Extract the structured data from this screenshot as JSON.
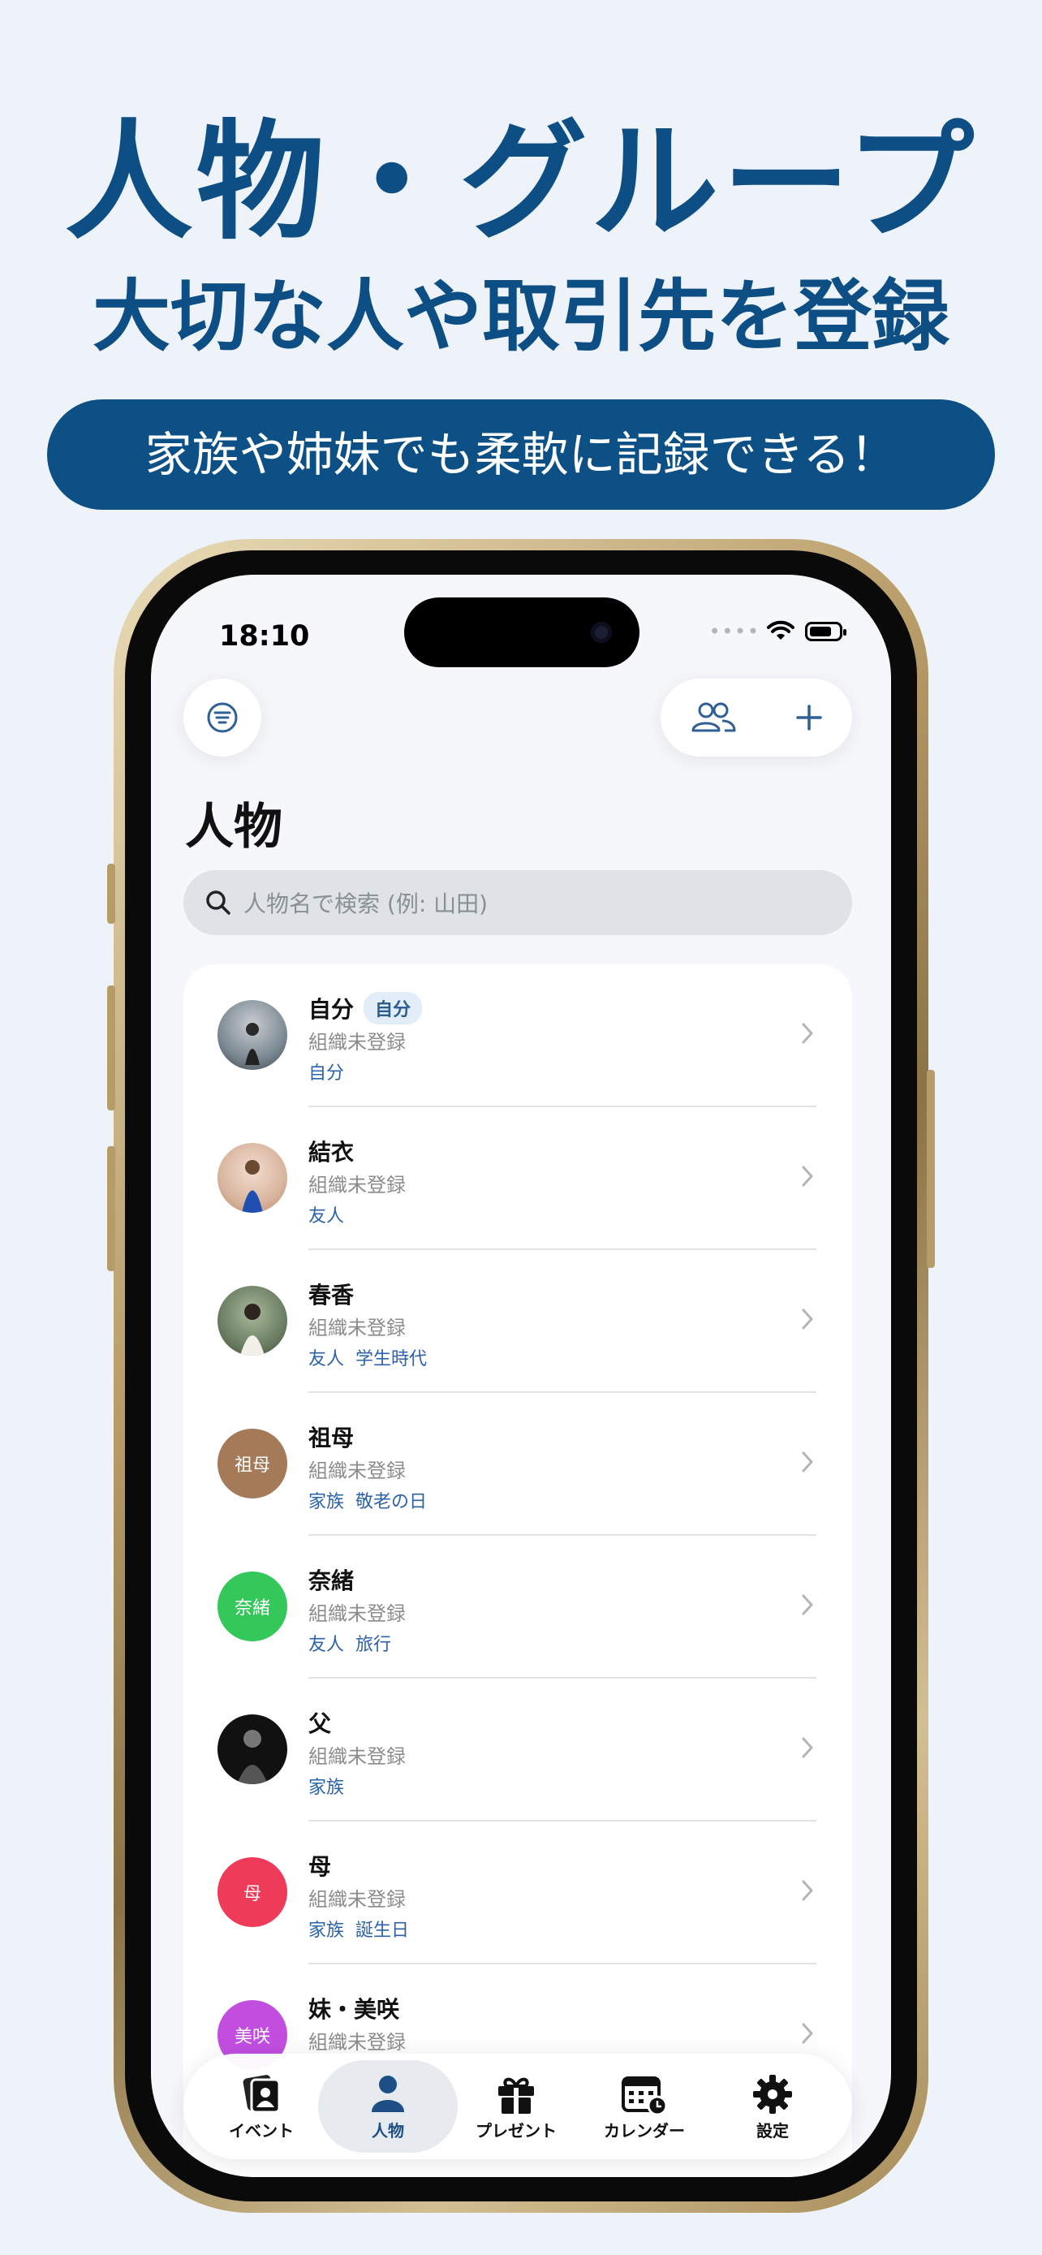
{
  "promo": {
    "title": "人物・グループ",
    "subtitle": "大切な人や取引先を登録",
    "pill": "家族や姉妹でも柔軟に記録できる！"
  },
  "status": {
    "time": "18:10"
  },
  "screen": {
    "title": "人物",
    "search_placeholder": "人物名で検索 (例: 山田)"
  },
  "people": [
    {
      "name": "自分",
      "badge": "自分",
      "org": "組織未登録",
      "tags": [
        "自分"
      ],
      "avatar_type": "photo",
      "avatar_color": "#7c8a94"
    },
    {
      "name": "結衣",
      "org": "組織未登録",
      "tags": [
        "友人"
      ],
      "avatar_type": "photo",
      "avatar_color": "#c99a7a"
    },
    {
      "name": "春香",
      "org": "組織未登録",
      "tags": [
        "友人",
        "学生時代"
      ],
      "avatar_type": "photo",
      "avatar_color": "#6c7f63"
    },
    {
      "name": "祖母",
      "org": "組織未登録",
      "tags": [
        "家族",
        "敬老の日"
      ],
      "avatar_type": "text",
      "avatar_text": "祖母",
      "avatar_color": "#a57a58"
    },
    {
      "name": "奈緒",
      "org": "組織未登録",
      "tags": [
        "友人",
        "旅行"
      ],
      "avatar_type": "text",
      "avatar_text": "奈緒",
      "avatar_color": "#34c759"
    },
    {
      "name": "父",
      "org": "組織未登録",
      "tags": [
        "家族"
      ],
      "avatar_type": "photo",
      "avatar_color": "#1a1a1a"
    },
    {
      "name": "母",
      "org": "組織未登録",
      "tags": [
        "家族",
        "誕生日"
      ],
      "avatar_type": "text",
      "avatar_text": "母",
      "avatar_color": "#ef3b5a"
    },
    {
      "name": "妹・美咲",
      "org": "組織未登録",
      "tags": [],
      "avatar_type": "text",
      "avatar_text": "美咲",
      "avatar_color": "#c24ee0"
    }
  ],
  "tabs": [
    {
      "label": "イベント",
      "icon": "event-icon",
      "active": false
    },
    {
      "label": "人物",
      "icon": "person-icon",
      "active": true
    },
    {
      "label": "プレゼント",
      "icon": "gift-icon",
      "active": false
    },
    {
      "label": "カレンダー",
      "icon": "calendar-icon",
      "active": false
    },
    {
      "label": "設定",
      "icon": "gear-icon",
      "active": false
    }
  ]
}
